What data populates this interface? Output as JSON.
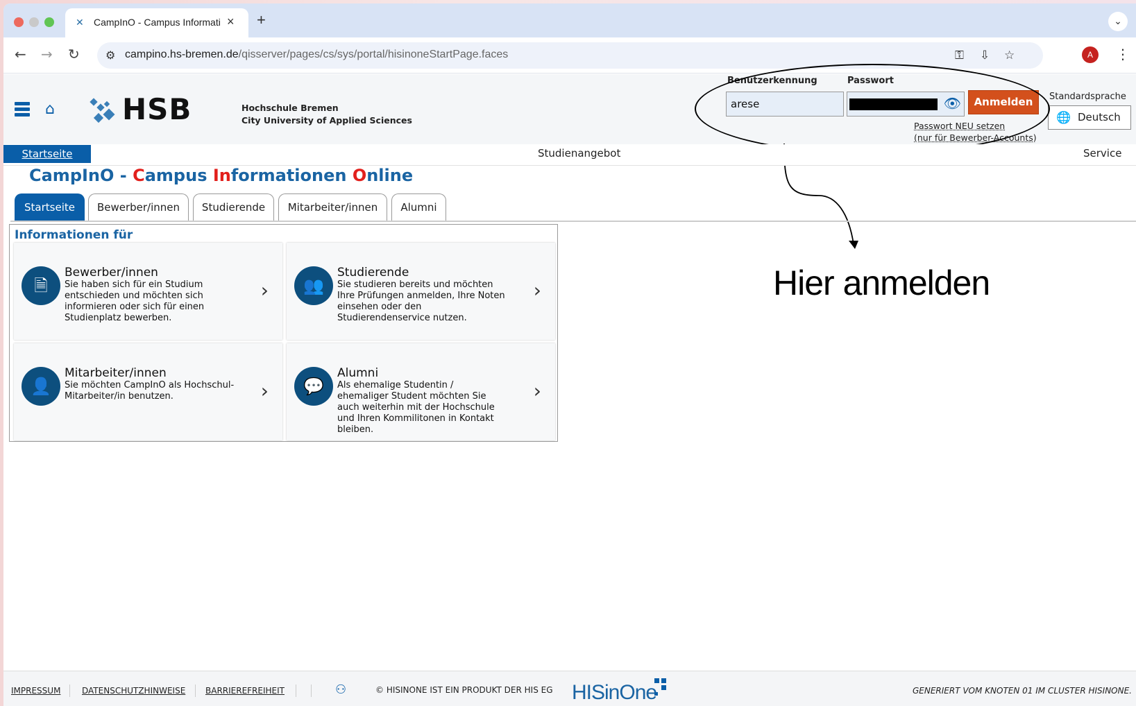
{
  "browser": {
    "tab_title": "CampInO - Campus Informati",
    "url_host": "campino.hs-bremen.de",
    "url_path": "/qisserver/pages/cs/sys/portal/hisinoneStartPage.faces",
    "avatar_letter": "A"
  },
  "header": {
    "logo_text": "HSB",
    "uni_line1": "Hochschule Bremen",
    "uni_line2": "City University of Applied Sciences",
    "user_label": "Benutzerkennung",
    "user_value": "arese",
    "pass_label": "Passwort",
    "login_button": "Anmelden",
    "pw_reset_line1": "Passwort NEU setzen",
    "pw_reset_line2": "(nur für Bewerber-Accounts)",
    "lang_label": "Standardsprache",
    "lang_button": "Deutsch"
  },
  "annotation": {
    "text": "Hier anmelden"
  },
  "menubar": {
    "items": [
      "Startseite",
      "Studienangebot",
      "Service"
    ]
  },
  "title": {
    "part1": "CampInO - ",
    "c": "C",
    "ampus": "ampus ",
    "i": "In",
    "nformationen": "formationen ",
    "o": "O",
    "nline": "nline"
  },
  "tabs": [
    "Startseite",
    "Bewerber/innen",
    "Studierende",
    "Mitarbeiter/innen",
    "Alumni"
  ],
  "info": {
    "heading": "Informationen für",
    "cards": [
      {
        "title": "Bewerber/innen",
        "desc": "Sie haben sich für ein Studium entschieden und möchten sich informieren oder sich für einen Studienplatz bewerben.",
        "icon": "document-icon"
      },
      {
        "title": "Studierende",
        "desc": "Sie studieren bereits und möchten Ihre Prüfungen anmelden, Ihre Noten einsehen oder den Studierendenservice nutzen.",
        "icon": "students-icon"
      },
      {
        "title": "Mitarbeiter/innen",
        "desc": "Sie möchten CampInO als Hochschul-Mitarbeiter/in benutzen.",
        "icon": "staff-icon"
      },
      {
        "title": "Alumni",
        "desc": "Als ehemalige Studentin / ehemaliger Student möchten Sie auch weiterhin mit der Hochschule und Ihren Kommilitonen in Kontakt bleiben.",
        "icon": "alumni-icon"
      }
    ]
  },
  "footer": {
    "impressum": "IMPRESSUM",
    "datenschutz": "DATENSCHUTZHINWEISE",
    "barriere": "BARRIEREFREIHEIT",
    "copyright": "© HISINONE IST EIN PRODUKT DER HIS EG",
    "brand": "HISinOne",
    "generated": "GENERIERT VOM KNOTEN 01 IM CLUSTER HISINONE."
  }
}
